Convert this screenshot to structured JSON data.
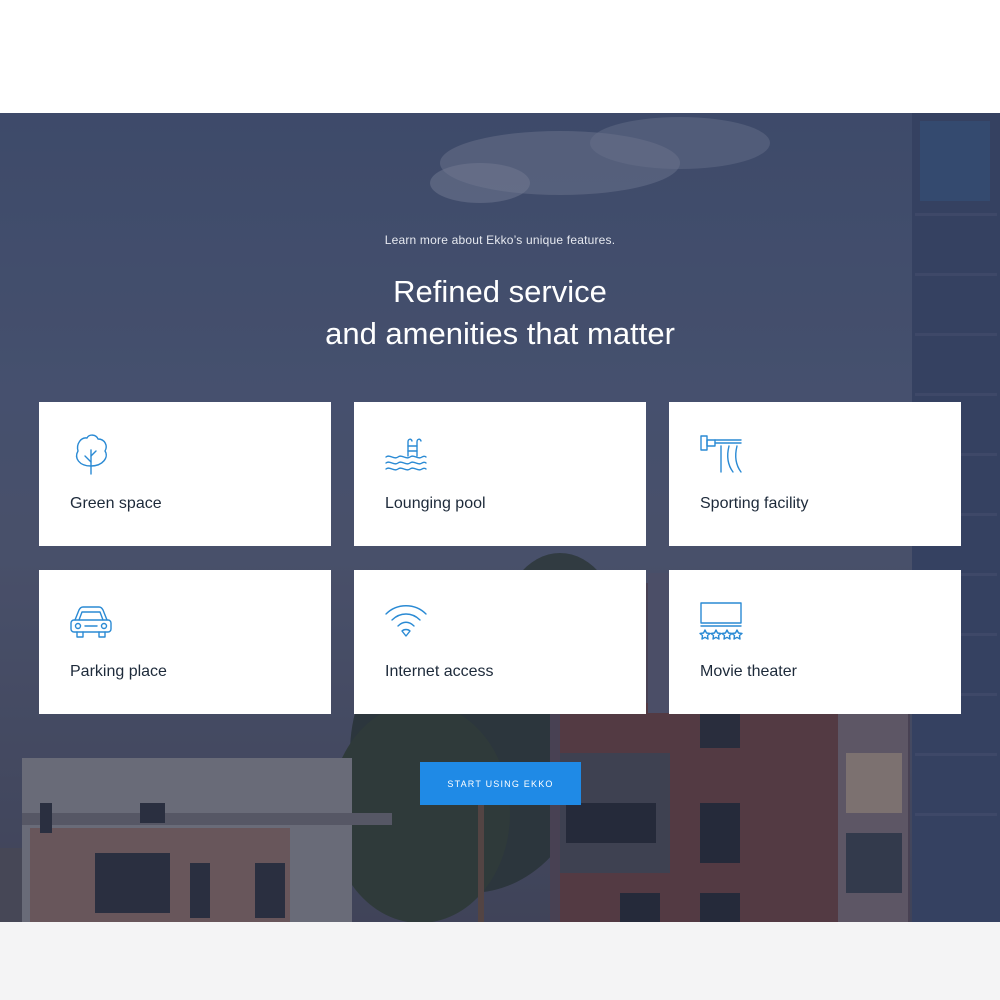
{
  "hero": {
    "eyebrow": "Learn more about Ekko’s unique features.",
    "headline_line1": "Refined service",
    "headline_line2": "and amenities that matter"
  },
  "features": [
    {
      "label": "Green space",
      "icon": "tree-icon"
    },
    {
      "label": "Lounging pool",
      "icon": "pool-icon"
    },
    {
      "label": "Sporting facility",
      "icon": "sport-facility-icon"
    },
    {
      "label": "Parking place",
      "icon": "car-icon"
    },
    {
      "label": "Internet access",
      "icon": "wifi-icon"
    },
    {
      "label": "Movie theater",
      "icon": "theater-icon"
    }
  ],
  "cta": {
    "label": "START USING EKKO"
  },
  "colors": {
    "accent": "#1f8ae6",
    "icon_stroke": "#2a8ad4",
    "card_text": "#1d2a3a"
  }
}
